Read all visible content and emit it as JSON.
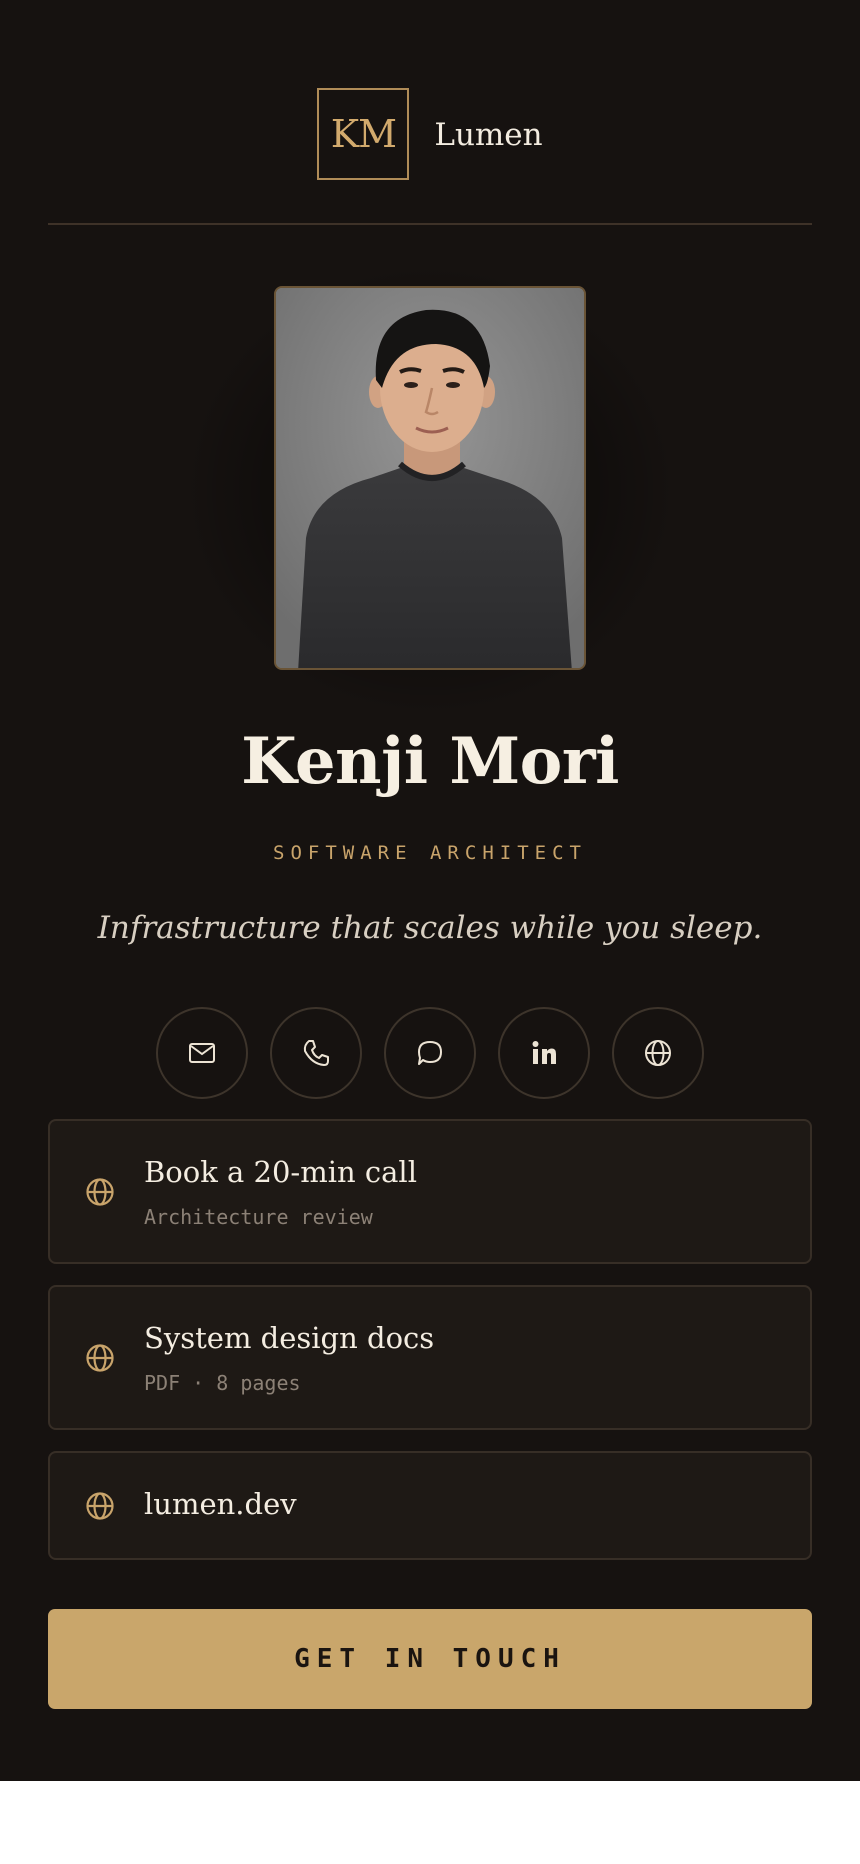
{
  "brand": {
    "monogram": "KM",
    "name": "Lumen"
  },
  "profile": {
    "name": "Kenji Mori",
    "role": "SOFTWARE ARCHITECT",
    "tagline": "Infrastructure that scales while you sleep."
  },
  "socials": [
    {
      "icon": "mail-icon"
    },
    {
      "icon": "phone-icon"
    },
    {
      "icon": "chat-icon"
    },
    {
      "icon": "linkedin-icon"
    },
    {
      "icon": "globe-icon"
    }
  ],
  "links": [
    {
      "icon": "globe-icon",
      "title": "Book a 20-min call",
      "subtitle": "Architecture review"
    },
    {
      "icon": "globe-icon",
      "title": "System design docs",
      "subtitle": "PDF · 8 pages"
    },
    {
      "icon": "globe-icon",
      "title": "lumen.dev"
    }
  ],
  "cta": {
    "label": "GET IN TOUCH"
  },
  "colors": {
    "background": "#161210",
    "accent": "#c9a66b",
    "card": "#1e1915",
    "text": "#f4ede1"
  }
}
